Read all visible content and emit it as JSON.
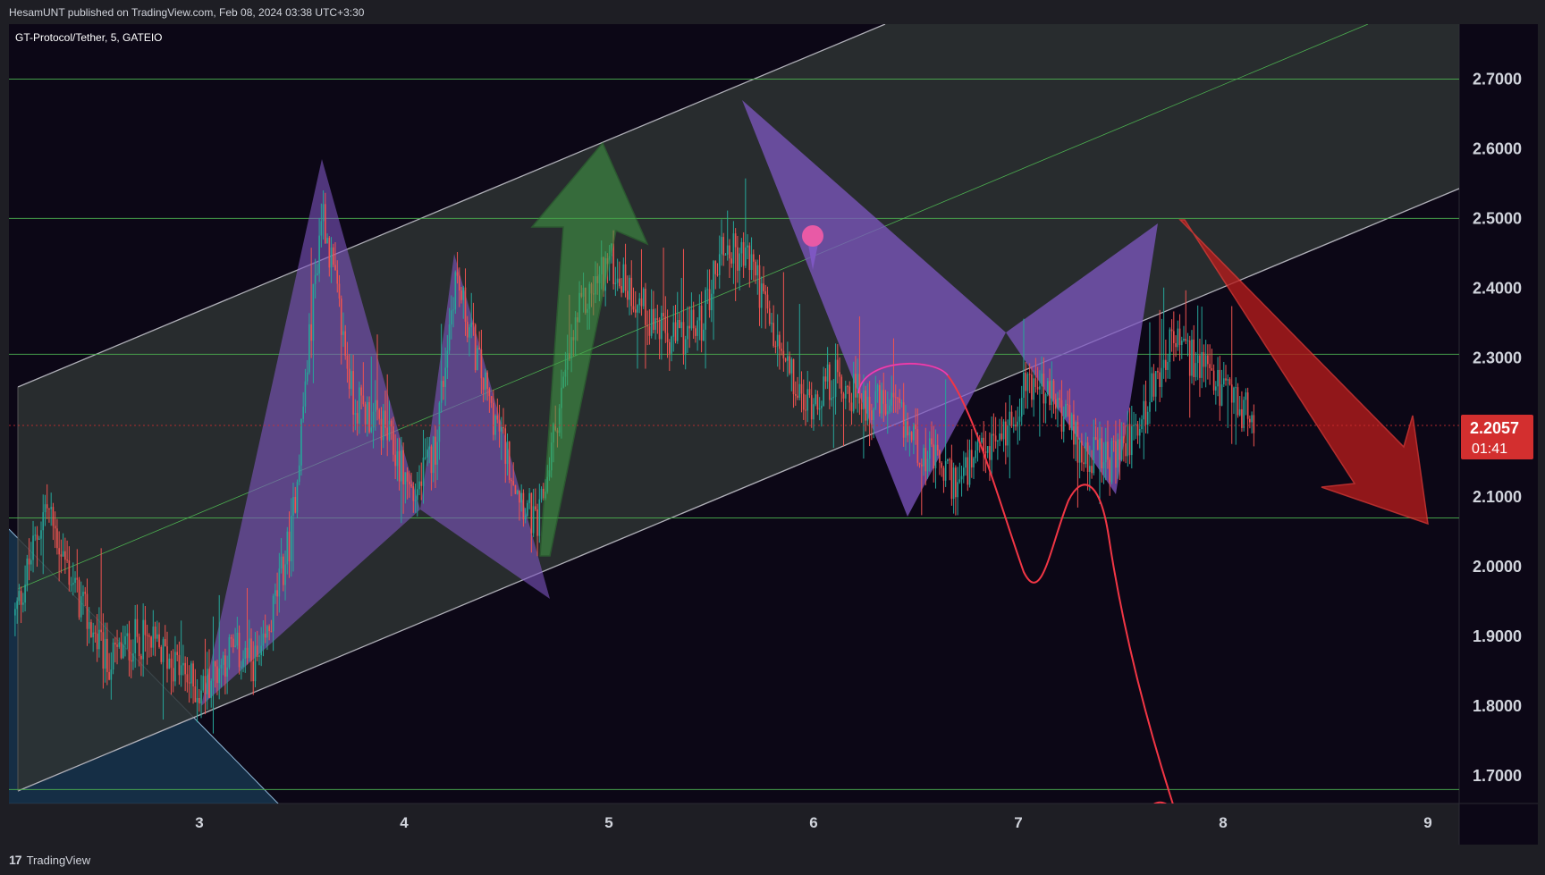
{
  "header": {
    "published_text": "HesamUNT published on TradingView.com, Feb 08, 2024 03:38 UTC+3:30"
  },
  "footer": {
    "brand_mark": "17",
    "brand_name": "TradingView"
  },
  "chart_data": {
    "type": "candlestick",
    "symbol_label": "GT-Protocol/Tether, 5, GATEIO",
    "x_ticks": [
      "3",
      "4",
      "5",
      "6",
      "7",
      "8",
      "9"
    ],
    "x_range": [
      2.1,
      9.0
    ],
    "y_ticks": [
      "2.7000",
      "2.6000",
      "2.5000",
      "2.4000",
      "2.3000",
      "2.1000",
      "2.0000",
      "1.9000",
      "1.8000",
      "1.7000"
    ],
    "y_range": [
      1.66,
      2.779
    ],
    "last_price": "2.2057",
    "countdown": "01:41",
    "horizontal_levels": [
      2.7,
      2.5,
      2.305,
      2.07,
      1.68
    ],
    "colors": {
      "background": "#0c0716",
      "up": "#26a69a",
      "down": "#ef5350",
      "level_line": "#4caf50",
      "channel": "#9e9e9e",
      "pattern": "#7e57c2",
      "arrow_up": "#43a047",
      "arrow_down": "#b71c1c",
      "price_label": "#d32f2f"
    },
    "price_path": [
      [
        2.1,
        1.93
      ],
      [
        2.25,
        2.09
      ],
      [
        2.4,
        1.96
      ],
      [
        2.55,
        1.86
      ],
      [
        2.7,
        1.9
      ],
      [
        2.85,
        1.87
      ],
      [
        3.0,
        1.82
      ],
      [
        3.15,
        1.88
      ],
      [
        3.3,
        1.86
      ],
      [
        3.45,
        2.05
      ],
      [
        3.6,
        2.52
      ],
      [
        3.75,
        2.24
      ],
      [
        3.9,
        2.2
      ],
      [
        4.05,
        2.1
      ],
      [
        4.15,
        2.17
      ],
      [
        4.25,
        2.42
      ],
      [
        4.4,
        2.25
      ],
      [
        4.55,
        2.12
      ],
      [
        4.65,
        2.05
      ],
      [
        4.75,
        2.22
      ],
      [
        4.85,
        2.36
      ],
      [
        5.0,
        2.44
      ],
      [
        5.15,
        2.38
      ],
      [
        5.3,
        2.32
      ],
      [
        5.45,
        2.35
      ],
      [
        5.55,
        2.46
      ],
      [
        5.7,
        2.44
      ],
      [
        5.8,
        2.33
      ],
      [
        5.95,
        2.23
      ],
      [
        6.1,
        2.27
      ],
      [
        6.25,
        2.24
      ],
      [
        6.4,
        2.22
      ],
      [
        6.55,
        2.16
      ],
      [
        6.7,
        2.12
      ],
      [
        6.8,
        2.15
      ],
      [
        6.95,
        2.2
      ],
      [
        7.05,
        2.27
      ],
      [
        7.2,
        2.23
      ],
      [
        7.3,
        2.17
      ],
      [
        7.45,
        2.15
      ],
      [
        7.6,
        2.21
      ],
      [
        7.75,
        2.33
      ],
      [
        7.9,
        2.28
      ],
      [
        8.0,
        2.25
      ],
      [
        8.15,
        2.21
      ]
    ]
  }
}
